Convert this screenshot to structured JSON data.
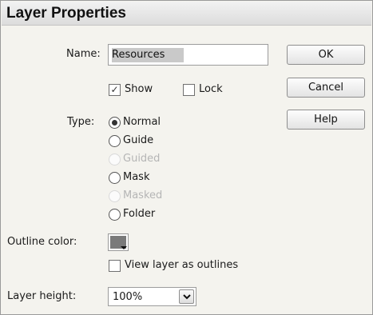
{
  "dialog": {
    "title": "Layer Properties"
  },
  "name_field": {
    "label": "Name:",
    "value": "Resources"
  },
  "options": {
    "show_label": "Show",
    "show_checked": true,
    "lock_label": "Lock",
    "lock_checked": false
  },
  "type": {
    "label": "Type:",
    "selected": "Normal",
    "items": [
      {
        "label": "Normal",
        "selected": true,
        "enabled": true
      },
      {
        "label": "Guide",
        "selected": false,
        "enabled": true
      },
      {
        "label": "Guided",
        "selected": false,
        "enabled": false
      },
      {
        "label": "Mask",
        "selected": false,
        "enabled": true
      },
      {
        "label": "Masked",
        "selected": false,
        "enabled": false
      },
      {
        "label": "Folder",
        "selected": false,
        "enabled": true
      }
    ]
  },
  "outline": {
    "label": "Outline color:",
    "color": "#7a7a7a",
    "view_as_outlines_label": "View layer as outlines",
    "view_as_outlines_checked": false
  },
  "layer_height": {
    "label": "Layer height:",
    "value": "100%"
  },
  "buttons": {
    "ok": "OK",
    "cancel": "Cancel",
    "help": "Help"
  }
}
